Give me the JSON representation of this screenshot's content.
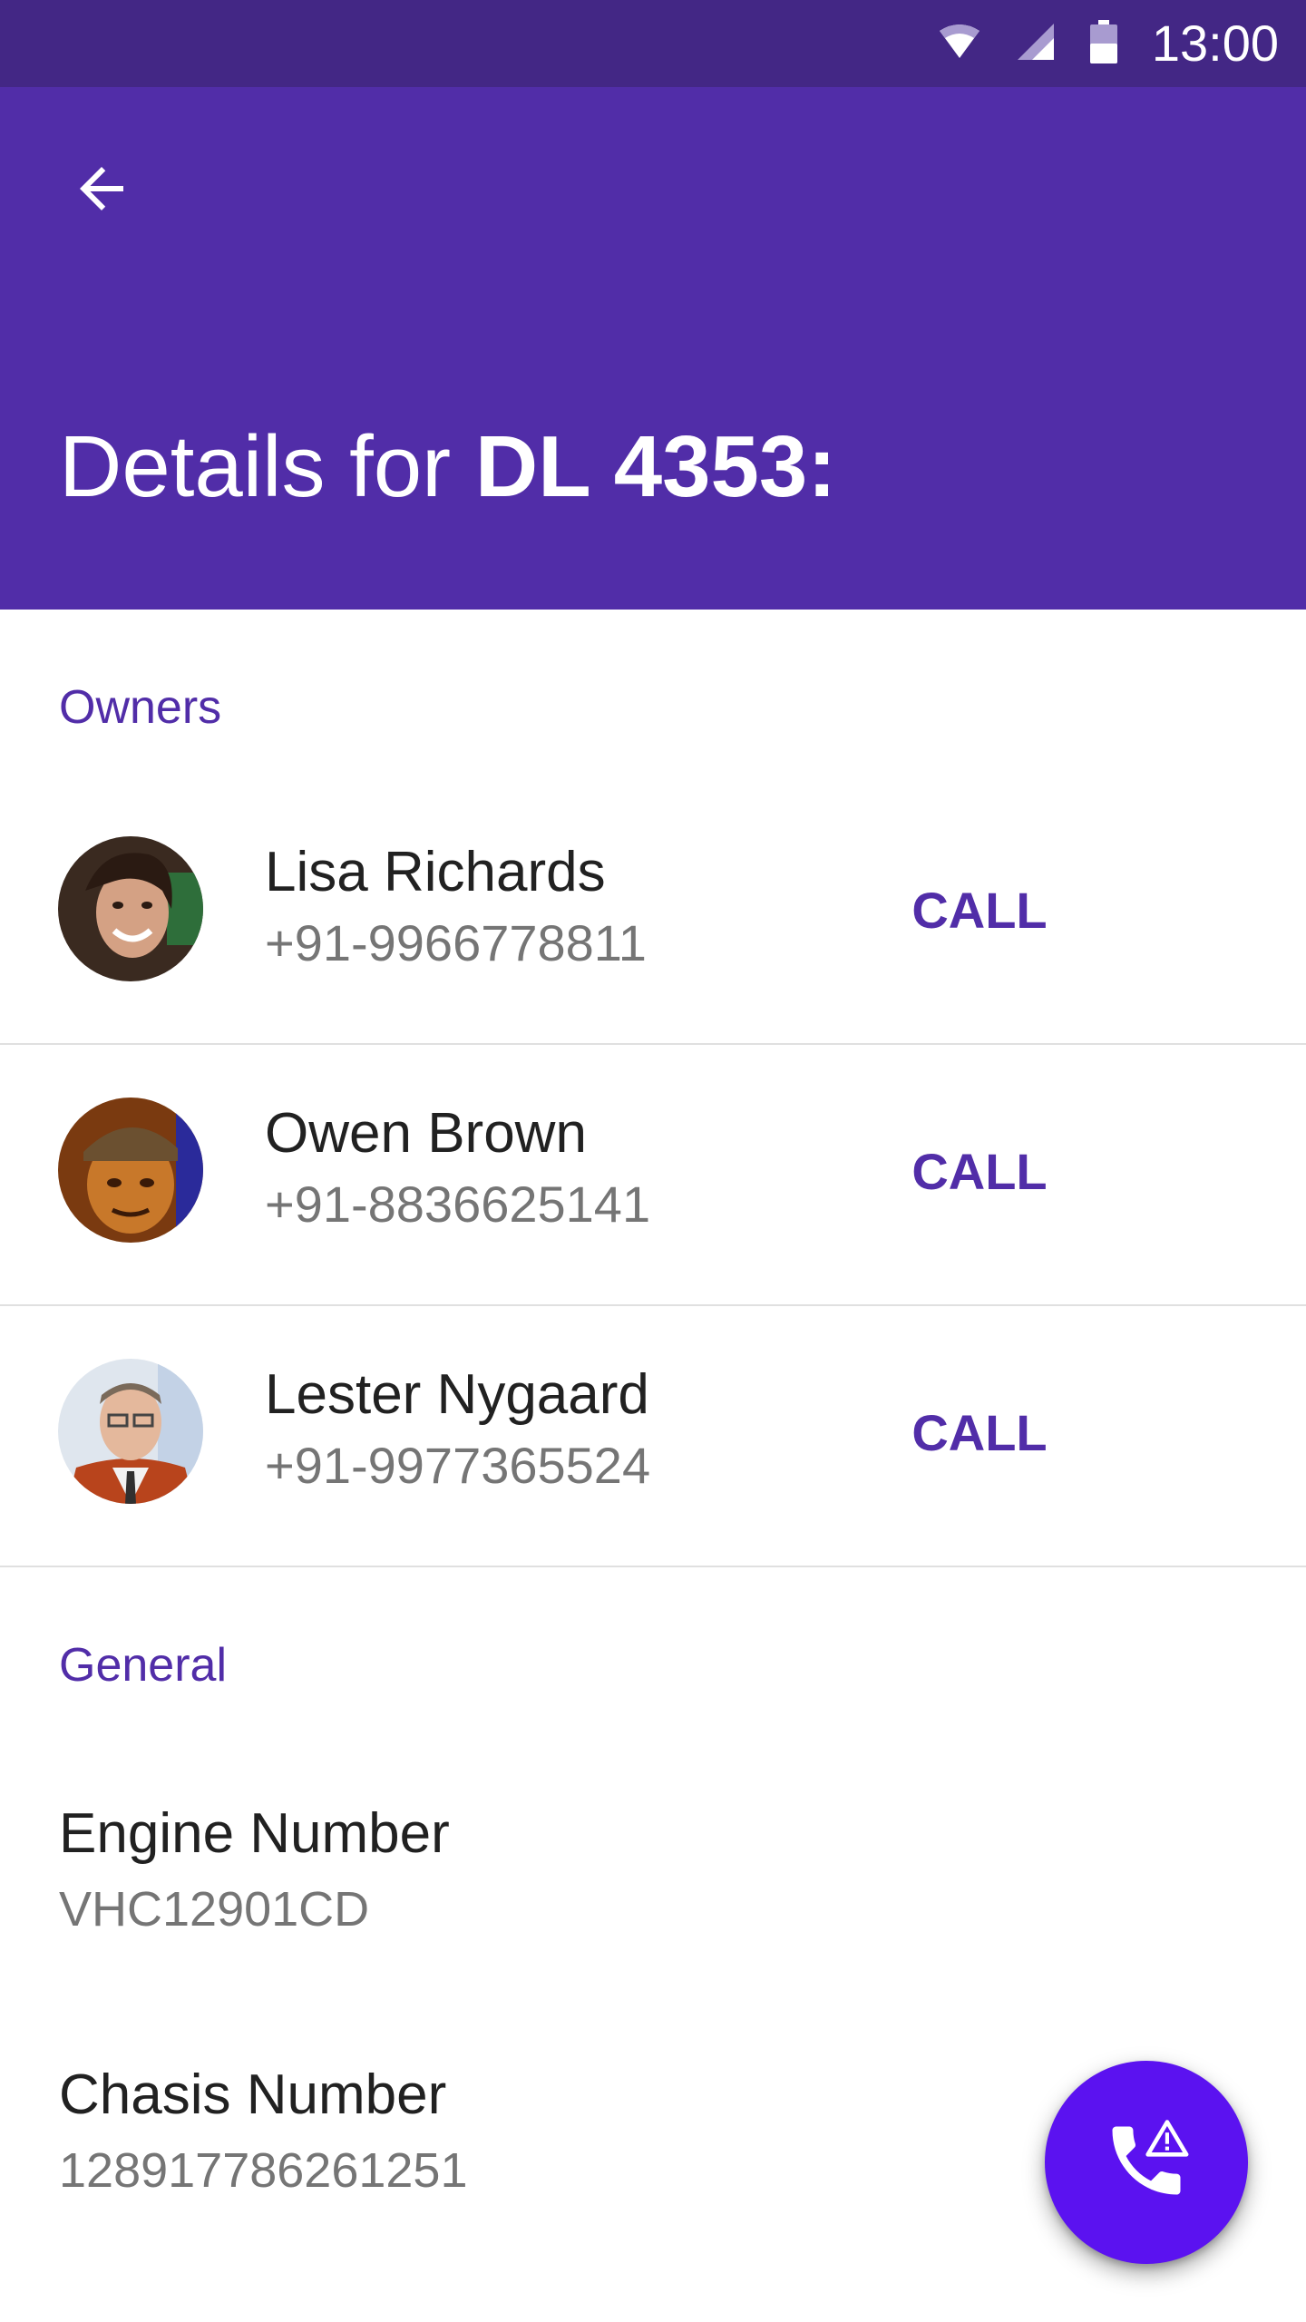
{
  "status_bar": {
    "time": "13:00",
    "icons": [
      "wifi-icon",
      "signal-icon",
      "battery-icon"
    ]
  },
  "app_bar": {
    "back_icon": "arrow-back-icon",
    "title_prefix": "Details for ",
    "title_bold": "DL 4353:"
  },
  "owners_section": {
    "header": "Owners",
    "owners": [
      {
        "name": "Lisa Richards",
        "phone": "+91-9966778811",
        "call_label": "CALL"
      },
      {
        "name": "Owen Brown",
        "phone": "+91-8836625141",
        "call_label": "CALL"
      },
      {
        "name": "Lester Nygaard",
        "phone": "+91-9977365524",
        "call_label": "CALL"
      }
    ]
  },
  "general_section": {
    "header": "General",
    "fields": [
      {
        "label": "Engine Number",
        "value": "VHC12901CD"
      },
      {
        "label": "Chasis Number",
        "value": "128917786261251"
      }
    ]
  },
  "fab": {
    "icon": "phone-alert-icon"
  },
  "colors": {
    "status_bar": "#432785",
    "primary": "#512DA8",
    "fab": "#5B12F0"
  }
}
